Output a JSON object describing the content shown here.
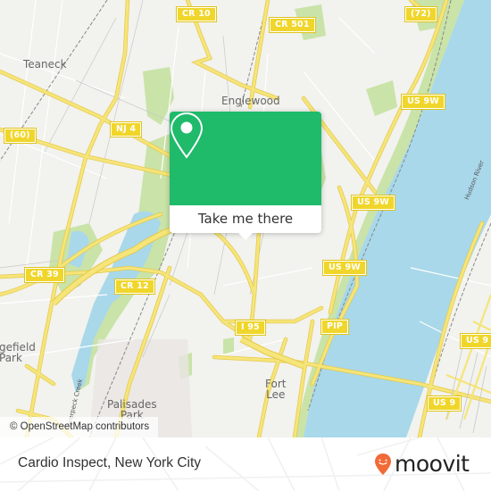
{
  "map": {
    "colors": {
      "land": "#f2f2ee",
      "water": "#a8d8ea",
      "park": "#c9e3a8",
      "road_major": "#f5e57a",
      "road_border": "#e6c94a",
      "road_minor": "#ffffff",
      "shield": "#f0d62b"
    },
    "places": [
      {
        "name": "Teaneck"
      },
      {
        "name": "Englewood"
      },
      {
        "name": "gefield\nPark"
      },
      {
        "name": "Palisades\nPark"
      },
      {
        "name": "Fort\nLee"
      }
    ],
    "road_shields": [
      {
        "label": "CR 10"
      },
      {
        "label": "CR 501"
      },
      {
        "label": "(72)"
      },
      {
        "label": "US 9W"
      },
      {
        "label": "(60)"
      },
      {
        "label": "NJ 4"
      },
      {
        "label": "US 9W"
      },
      {
        "label": "US 9W"
      },
      {
        "label": "CR 39"
      },
      {
        "label": "CR 12"
      },
      {
        "label": "I 95"
      },
      {
        "label": "PIP"
      },
      {
        "label": "US 9"
      },
      {
        "label": "US 9"
      }
    ],
    "water_labels": {
      "river": "Hudson River",
      "creek": "Overpeck Creek"
    },
    "attribution": "© OpenStreetMap contributors"
  },
  "popup": {
    "icon": "map-pin-icon",
    "button_label": "Take me there",
    "accent": "#1fba6a"
  },
  "footer": {
    "title": "Cardio Inspect, New York City",
    "brand": "moovit",
    "brand_icon": "moovit-pin-smile-icon",
    "brand_color": "#f26a37"
  }
}
